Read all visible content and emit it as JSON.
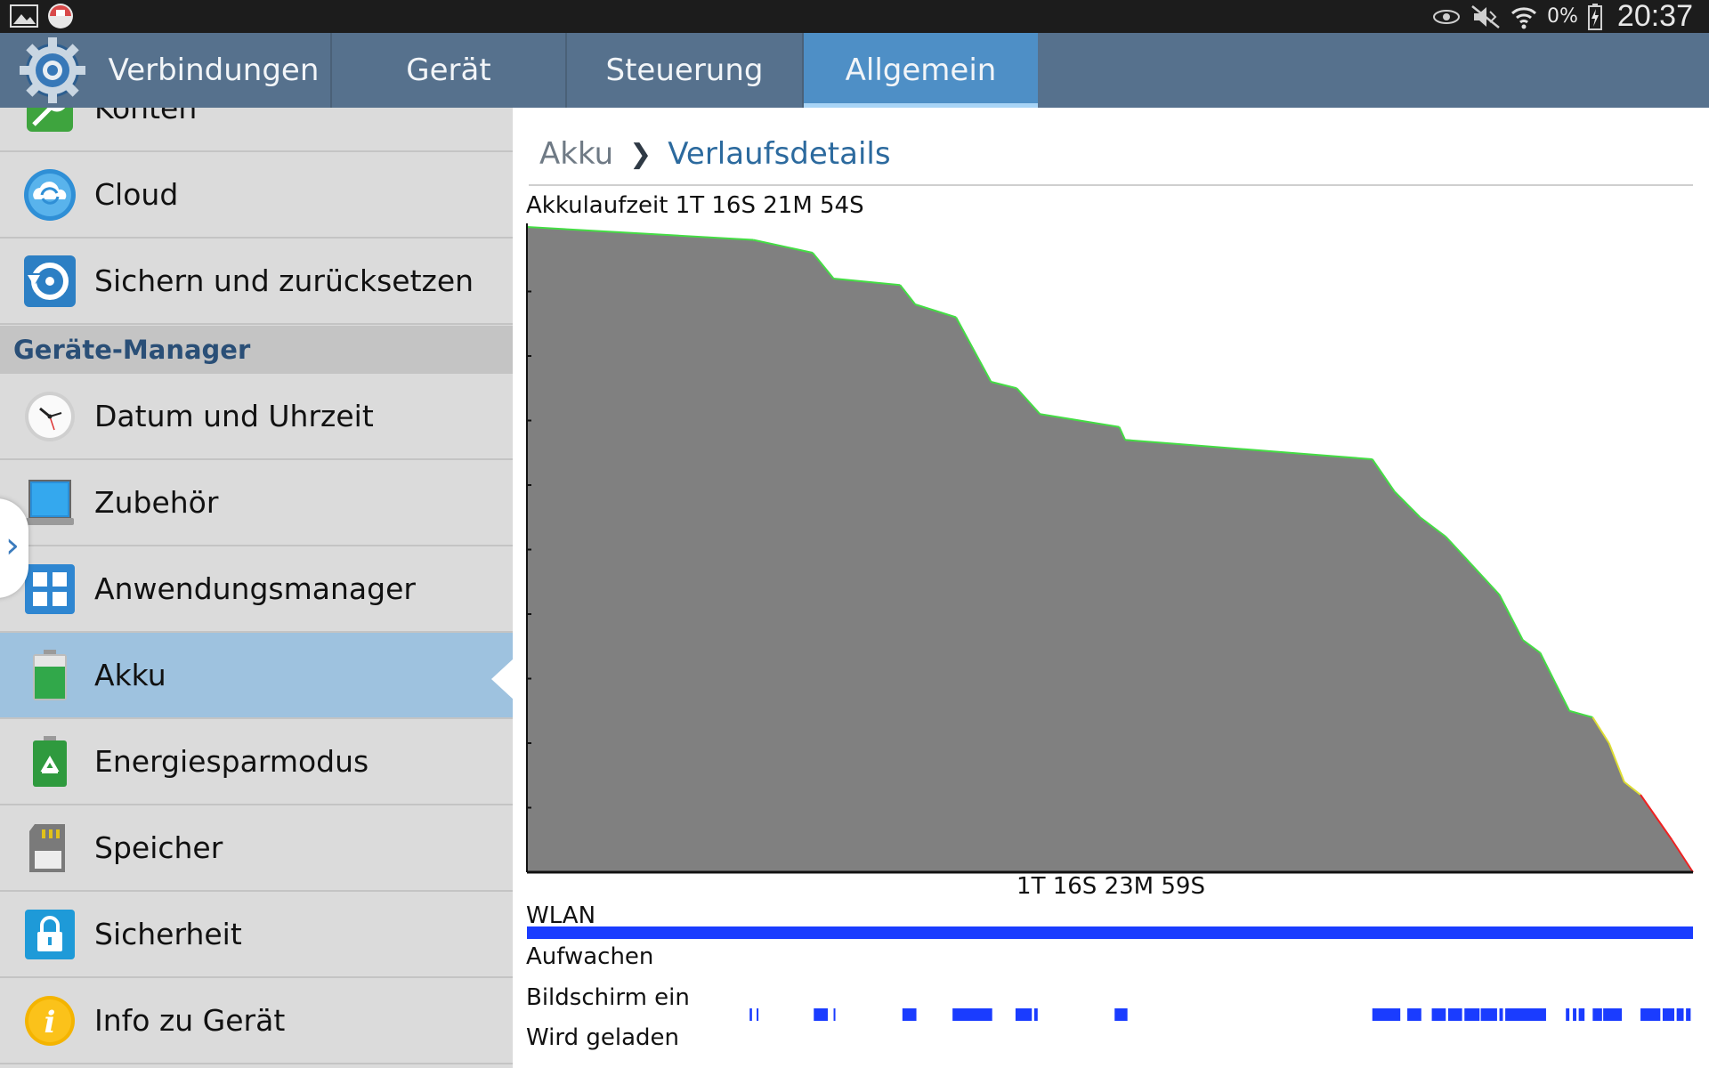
{
  "status_bar": {
    "left_icons": [
      "gallery-icon",
      "app-notification-icon"
    ],
    "right_icons": [
      "smart-stay-eye-icon",
      "mute-icon",
      "wifi-icon",
      "battery-charging-icon"
    ],
    "battery_percent": "0%",
    "time": "20:37"
  },
  "tabs": [
    {
      "label": "Verbindungen",
      "active": false
    },
    {
      "label": "Gerät",
      "active": false
    },
    {
      "label": "Steuerung",
      "active": false
    },
    {
      "label": "Allgemein",
      "active": true
    }
  ],
  "sidebar": {
    "items": [
      {
        "label": "Konten",
        "icon": "key-icon"
      },
      {
        "label": "Cloud",
        "icon": "cloud-sync-icon"
      },
      {
        "label": "Sichern und zurücksetzen",
        "icon": "backup-restore-icon"
      },
      {
        "label": "Datum und Uhrzeit",
        "icon": "clock-icon"
      },
      {
        "label": "Zubehör",
        "icon": "accessory-icon"
      },
      {
        "label": "Anwendungsmanager",
        "icon": "app-grid-icon"
      },
      {
        "label": "Akku",
        "icon": "battery-icon",
        "active": true
      },
      {
        "label": "Energiesparmodus",
        "icon": "power-saving-icon"
      },
      {
        "label": "Speicher",
        "icon": "sd-card-icon"
      },
      {
        "label": "Sicherheit",
        "icon": "lock-icon"
      },
      {
        "label": "Info zu Gerät",
        "icon": "info-icon"
      }
    ],
    "section_header": "Geräte-Manager"
  },
  "breadcrumb": {
    "parent": "Akku",
    "current": "Verlaufsdetails"
  },
  "battery_uptime_label": "Akkulaufzeit 1T 16S 21M 54S",
  "chart_data": {
    "type": "area",
    "title": "Akkulaufzeit 1T 16S 21M 54S",
    "xlabel": "1T 16S 23M 59S",
    "ylabel": "",
    "x_unit": "fraction of elapsed time",
    "y_unit": "battery level (%)",
    "ylim": [
      0,
      100
    ],
    "colors": {
      "fill": "#808080",
      "high": "#44dd44",
      "medium": "#dddd33",
      "low": "#ee2222"
    },
    "points": [
      [
        0.0,
        100
      ],
      [
        0.194,
        98
      ],
      [
        0.245,
        96
      ],
      [
        0.263,
        92
      ],
      [
        0.32,
        91
      ],
      [
        0.333,
        88
      ],
      [
        0.368,
        86
      ],
      [
        0.398,
        76
      ],
      [
        0.42,
        75
      ],
      [
        0.44,
        71
      ],
      [
        0.508,
        69
      ],
      [
        0.513,
        67
      ],
      [
        0.725,
        64
      ],
      [
        0.744,
        59
      ],
      [
        0.766,
        55
      ],
      [
        0.788,
        52
      ],
      [
        0.834,
        43
      ],
      [
        0.854,
        36
      ],
      [
        0.869,
        34
      ],
      [
        0.894,
        25
      ],
      [
        0.914,
        24
      ],
      [
        0.928,
        20
      ],
      [
        0.941,
        14
      ],
      [
        0.955,
        12
      ],
      [
        0.982,
        5
      ],
      [
        1.0,
        0
      ]
    ],
    "tracks": [
      {
        "name": "WLAN",
        "segments": [
          [
            0.0,
            1.0
          ]
        ]
      },
      {
        "name": "Aufwachen",
        "segments": []
      },
      {
        "name": "Bildschirm ein",
        "segments": []
      },
      {
        "name": "Wird geladen",
        "segments": []
      }
    ],
    "screen_on_marks": [
      [
        0.191,
        0.193
      ],
      [
        0.197,
        0.198
      ],
      [
        0.246,
        0.258
      ],
      [
        0.263,
        0.264
      ],
      [
        0.322,
        0.334
      ],
      [
        0.365,
        0.399
      ],
      [
        0.419,
        0.433
      ],
      [
        0.435,
        0.438
      ],
      [
        0.504,
        0.515
      ],
      [
        0.725,
        0.749
      ],
      [
        0.755,
        0.767
      ],
      [
        0.776,
        0.788
      ],
      [
        0.79,
        0.802
      ],
      [
        0.804,
        0.817
      ],
      [
        0.818,
        0.832
      ],
      [
        0.834,
        0.837
      ],
      [
        0.839,
        0.874
      ],
      [
        0.891,
        0.894
      ],
      [
        0.897,
        0.9
      ],
      [
        0.902,
        0.907
      ],
      [
        0.914,
        0.922
      ],
      [
        0.923,
        0.939
      ],
      [
        0.955,
        0.972
      ],
      [
        0.974,
        0.984
      ],
      [
        0.986,
        0.992
      ],
      [
        0.994,
        0.998
      ]
    ]
  }
}
